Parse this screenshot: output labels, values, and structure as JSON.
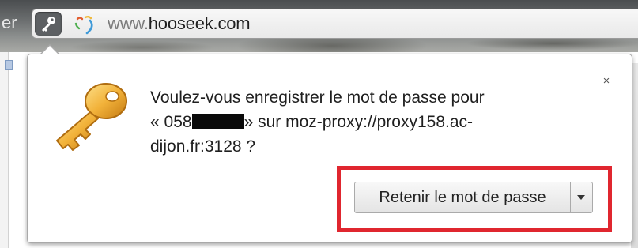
{
  "browser": {
    "left_partial_text": "er",
    "url_prefix": "www.",
    "url_domain": "hooseek.com"
  },
  "password_bubble": {
    "message_line1": "Voulez-vous enregistrer le mot de passe pour",
    "message_user_prefix": "« 058",
    "message_user_suffix": "» sur moz-proxy://proxy158.ac-",
    "message_line3": "dijon.fr:3128 ?",
    "close_label": "×",
    "save_button_label": "Retenir le mot de passe"
  },
  "icons": {
    "address_key": "key-icon",
    "loading": "loading-spinner-icon",
    "bubble_key": "golden-key-icon",
    "dropdown": "chevron-down-icon"
  },
  "colors": {
    "highlight": "#e0262f",
    "key_gold": "#f2b23a"
  }
}
